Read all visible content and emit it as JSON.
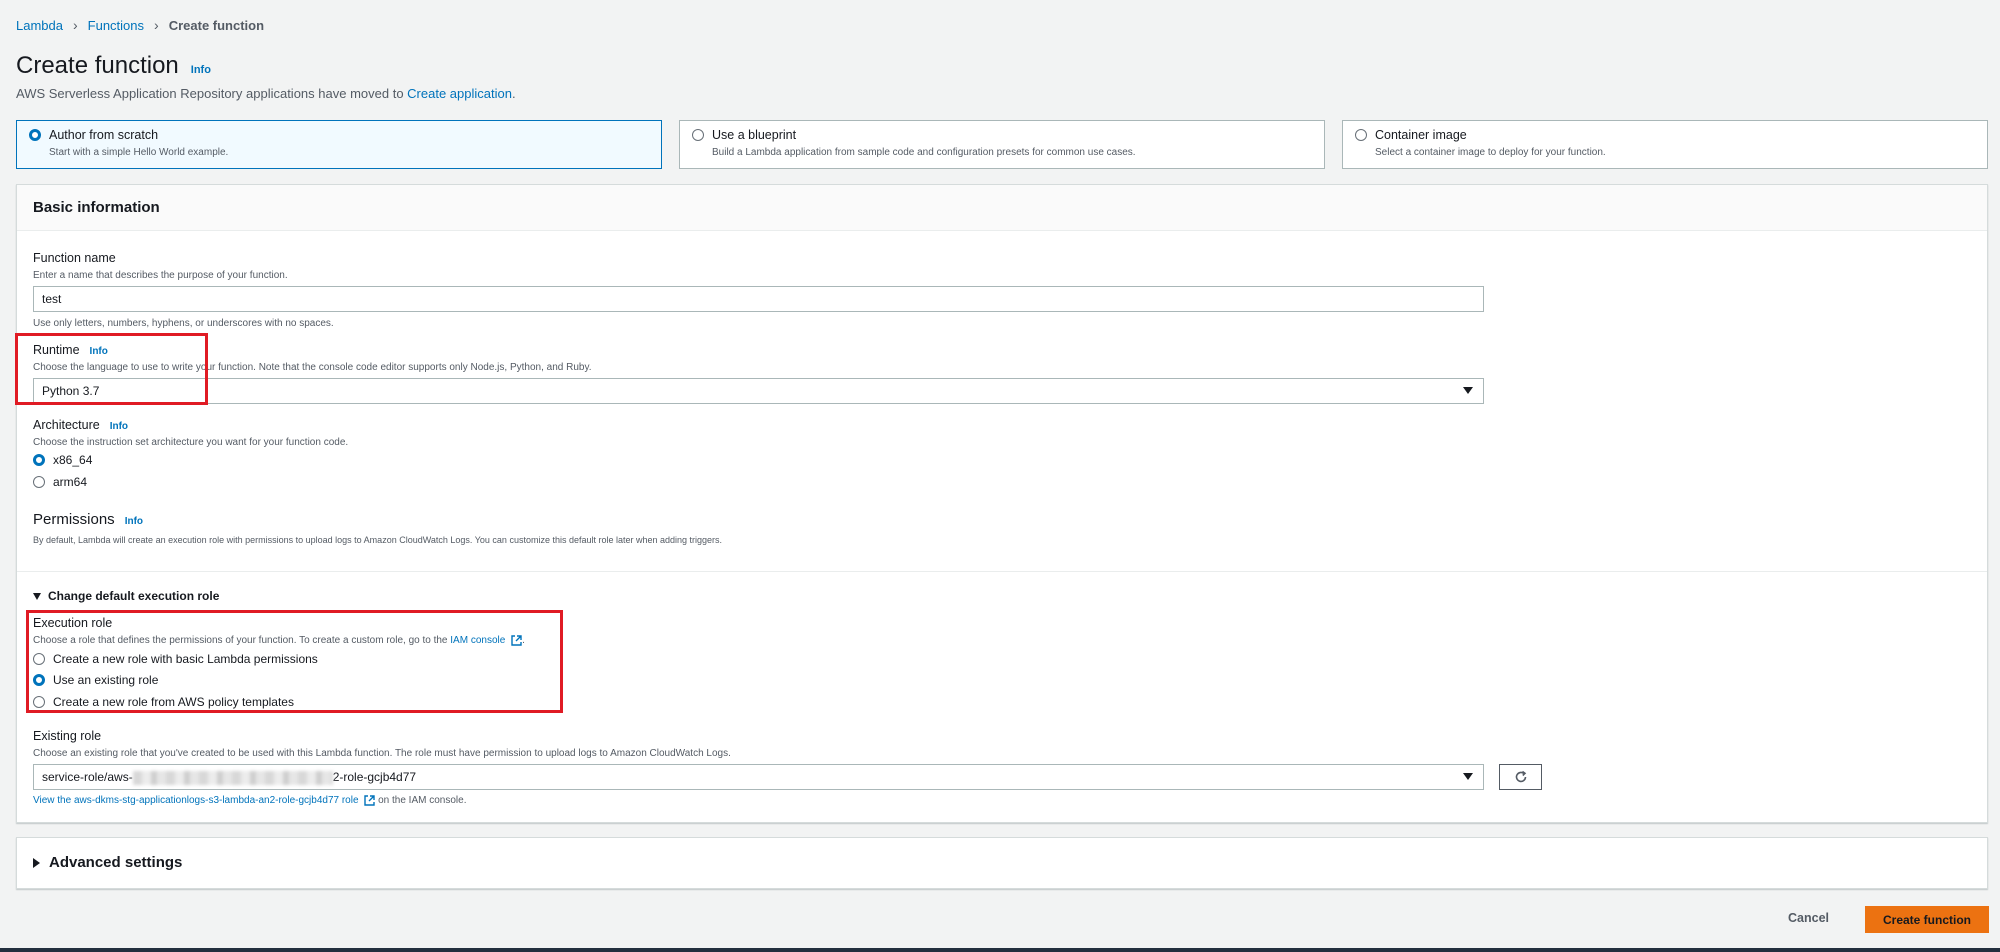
{
  "breadcrumb": {
    "items": [
      "Lambda",
      "Functions"
    ],
    "current": "Create function"
  },
  "page": {
    "title": "Create function",
    "info": "Info",
    "subtitle_prefix": "AWS Serverless Application Repository applications have moved to ",
    "subtitle_link": "Create application",
    "subtitle_suffix": "."
  },
  "tiles": [
    {
      "title": "Author from scratch",
      "desc": "Start with a simple Hello World example.",
      "selected": true
    },
    {
      "title": "Use a blueprint",
      "desc": "Build a Lambda application from sample code and configuration presets for common use cases.",
      "selected": false
    },
    {
      "title": "Container image",
      "desc": "Select a container image to deploy for your function.",
      "selected": false
    }
  ],
  "basic": {
    "header": "Basic information",
    "function_name": {
      "label": "Function name",
      "desc": "Enter a name that describes the purpose of your function.",
      "value": "test",
      "hint": "Use only letters, numbers, hyphens, or underscores with no spaces."
    },
    "runtime": {
      "label": "Runtime",
      "info": "Info",
      "desc": "Choose the language to use to write your function. Note that the console code editor supports only Node.js, Python, and Ruby.",
      "value": "Python 3.7"
    },
    "architecture": {
      "label": "Architecture",
      "info": "Info",
      "desc": "Choose the instruction set architecture you want for your function code.",
      "options": [
        "x86_64",
        "arm64"
      ],
      "selected": "x86_64"
    },
    "permissions": {
      "title": "Permissions",
      "info": "Info",
      "desc": "By default, Lambda will create an execution role with permissions to upload logs to Amazon CloudWatch Logs. You can customize this default role later when adding triggers."
    },
    "change_role": {
      "label": "Change default execution role",
      "expanded": true
    },
    "execution_role": {
      "label": "Execution role",
      "desc_prefix": "Choose a role that defines the permissions of your function. To create a custom role, go to the ",
      "desc_link": "IAM console",
      "desc_suffix": ".",
      "options": [
        "Create a new role with basic Lambda permissions",
        "Use an existing role",
        "Create a new role from AWS policy templates"
      ],
      "selected": "Use an existing role"
    },
    "existing_role": {
      "label": "Existing role",
      "desc": "Choose an existing role that you've created to be used with this Lambda function. The role must have permission to upload logs to Amazon CloudWatch Logs.",
      "value_prefix": "service-role/aws-",
      "value_suffix": "2-role-gcjb4d77",
      "view_link": "View the aws-dkms-stg-applicationlogs-s3-lambda-an2-role-gcjb4d77 role",
      "view_suffix": " on the IAM console."
    }
  },
  "advanced": {
    "label": "Advanced settings",
    "expanded": false
  },
  "actions": {
    "cancel": "Cancel",
    "create": "Create function"
  },
  "colors": {
    "accent": "#0073bb",
    "primary_button": "#ec7211",
    "highlight": "#e01b24"
  }
}
